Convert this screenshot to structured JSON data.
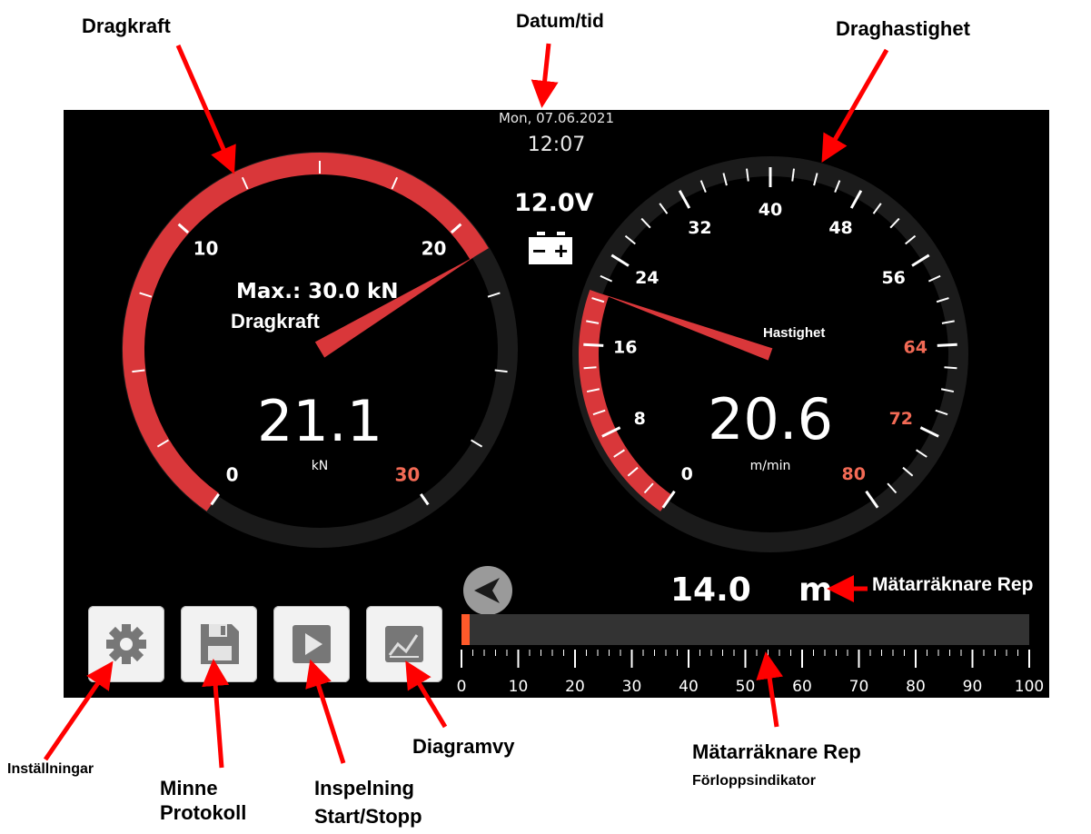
{
  "callouts": {
    "dragkraft": "Dragkraft",
    "datum_tid": "Datum/tid",
    "draghastighet": "Draghastighet",
    "matarraknare_rep_top": "Mätarräknare Rep",
    "installningar": "Inställningar",
    "minne": "Minne",
    "protokoll": "Protokoll",
    "inspelning": "Inspelning",
    "start_stopp": "Start/Stopp",
    "diagramvy": "Diagramvy",
    "matarraknare_rep": "Mätarräknare Rep",
    "forloppsindikator": "Förloppsindikator"
  },
  "header": {
    "date": "Mon, 07.06.2021",
    "time": "12:07",
    "battery_voltage": "12.0V",
    "battery_minus": "−",
    "battery_plus": "+"
  },
  "force_gauge": {
    "value": "21.1",
    "unit": "kN",
    "max_label": "Max.: 30.0 kN",
    "title": "Dragkraft",
    "scale_labels": [
      "0",
      "10",
      "20",
      "30"
    ],
    "scale_min": 0,
    "scale_max": 30,
    "needle_value": 21.1,
    "accent_color": "#d9373a",
    "max_label_color": "#f36a55"
  },
  "speed_gauge": {
    "value": "20.6",
    "unit": "m/min",
    "title": "Hastighet",
    "scale_labels": [
      "0",
      "8",
      "16",
      "24",
      "32",
      "40",
      "48",
      "56",
      "64",
      "72",
      "80"
    ],
    "scale_min": 0,
    "scale_max": 80,
    "needle_value": 20.6,
    "accent_color": "#d9373a",
    "warning_color": "#f36a55"
  },
  "rope_counter": {
    "value": "14.0",
    "unit": "m",
    "progress_percent": 1.5,
    "scale_labels": [
      "0",
      "10",
      "20",
      "30",
      "40",
      "50",
      "60",
      "70",
      "80",
      "90",
      "100"
    ],
    "bar_color": "#ff5a2a"
  },
  "buttons": [
    {
      "name": "settings-button",
      "icon": "gear-icon"
    },
    {
      "name": "memory-protocol-button",
      "icon": "floppy-disk-icon"
    },
    {
      "name": "record-start-stop-button",
      "icon": "play-icon"
    },
    {
      "name": "chart-view-button",
      "icon": "line-chart-icon"
    }
  ],
  "colors": {
    "background": "#000000",
    "accent_red": "#d9373a",
    "arrow_red": "#ff0000"
  }
}
